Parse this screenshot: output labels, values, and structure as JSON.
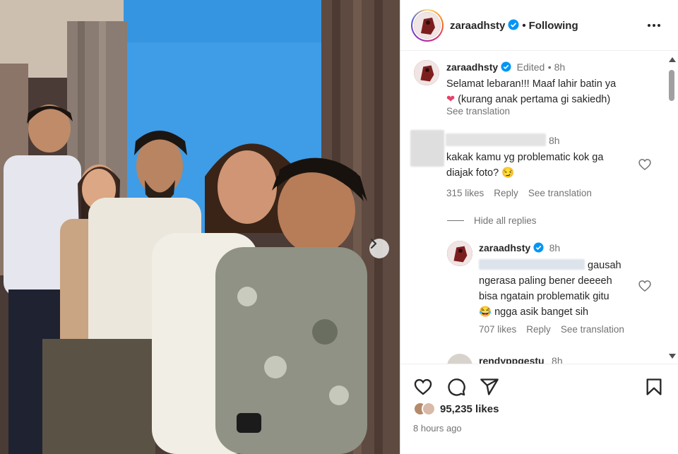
{
  "post": {
    "username": "zaraadhsty",
    "follow_status": "Following",
    "caption_edited": "Edited",
    "caption_time": "8h",
    "caption_line1": "Selamat lebaran!!! Maaf lahir batin ya",
    "caption_line2": "(kurang anak pertama gi sakiedh)",
    "caption_emoji": "❤",
    "see_translation": "See translation"
  },
  "comment1": {
    "time": "8h",
    "text_line1": "kakak kamu yg problematic kok ga",
    "text_line2": "diajak foto? 😏",
    "likes": "315 likes",
    "reply": "Reply",
    "see_translation": "See translation"
  },
  "hide_replies": "Hide all replies",
  "reply1": {
    "username": "zaraadhsty",
    "time": "8h",
    "text_line1": "gausah",
    "text_line2": "ngerasa paling bener deeeeh",
    "text_line3": "bisa ngatain problematik gitu",
    "text_line4": "ngga asik banget sih",
    "emoji": "😂",
    "likes": "707 likes",
    "reply": "Reply",
    "see_translation": "See translation"
  },
  "reply2": {
    "username": "rendyppgestu",
    "time": "8h"
  },
  "footer": {
    "likes": "95,235 likes",
    "ago": "8 hours ago"
  },
  "icons": [
    "chevron-right-icon",
    "verified-icon",
    "more-icon",
    "heart-icon",
    "comment-icon",
    "share-icon",
    "bookmark-icon"
  ],
  "colors": {
    "verified": "#0095f6",
    "muted": "#737373",
    "text": "#262626"
  }
}
